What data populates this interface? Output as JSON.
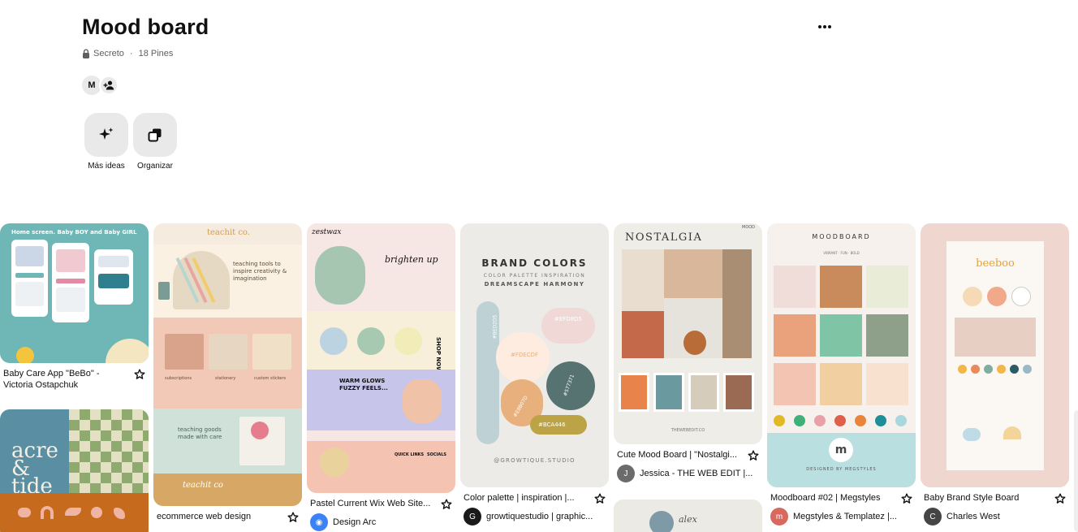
{
  "board": {
    "title": "Mood board",
    "privacy": "Secreto",
    "separator": "·",
    "pin_count": "18 Pines",
    "collaborator_initial": "M",
    "more_options_icon": "ellipsis-icon"
  },
  "actions": [
    {
      "label": "Más ideas",
      "icon": "sparkle-icon"
    },
    {
      "label": "Organizar",
      "icon": "organize-icon"
    }
  ],
  "pins": [
    {
      "title": "Baby Care App \"BeBo\" - Victoria Ostapchuk",
      "art": {
        "heading": "Home screen. Baby BOY and Baby GIRL"
      }
    },
    {
      "title": "ecommerce web design",
      "art": {
        "brand": "teachit co.",
        "line1": "teaching tools to inspire creativity & imagination",
        "line2": "subscriptions",
        "line3": "stationery",
        "line4": "custom stickers",
        "line5": "teaching goods made with care",
        "logo": "teachit co"
      }
    },
    {
      "title": "Pastel Current Wix Web Site...",
      "author": "Design Arc",
      "art": {
        "brand": "zestwax",
        "headline": "brighten up",
        "shop": "SHOP NOW",
        "warm": "WARM GLOWS FUZZY FEELS...",
        "quick": "QUICK LINKS",
        "socials": "SOCIALS"
      }
    },
    {
      "title": "Color palette | inspiration |...",
      "author": "growtiquestudio | graphic...",
      "art": {
        "heading": "BRAND COLORS",
        "sub": "COLOR PALETTE INSPIRATION",
        "name": "DREAMSCAPE HARMONY",
        "hex1": "#EFD8D5",
        "hex2": "#FDECDF",
        "hex3": "#577371",
        "hex4": "#BED2D5",
        "hex5": "#E8B07D",
        "hex6": "#BCA446",
        "footer": "@GROWTIQUE.STUDIO"
      }
    },
    {
      "title": "Cute Mood Board | \"Nostalgi...",
      "author": "Jessica - THE WEB EDIT |...",
      "art": {
        "heading": "NOSTALGIA",
        "corner": "MOOD",
        "footer": "THEWEBEDIT.CO"
      }
    },
    {
      "title": "Moodboard #02 | Megstyles",
      "author": "Megstyles & Templatez |...",
      "art": {
        "heading": "MOODBOARD",
        "tags": "VIBRANT · FUN · BOLD",
        "seal": "m",
        "footer": "DESIGNED BY MEGSTYLES"
      }
    },
    {
      "title": "Baby Brand Style Board",
      "author": "Charles West",
      "art": {
        "brand": "beeboo"
      }
    },
    {
      "title": "",
      "art": {
        "brand": "acre & tide"
      }
    },
    {
      "title": "",
      "art": {
        "brand": "alex"
      }
    }
  ],
  "colors": {
    "button_bg": "#e9e9e9",
    "text_primary": "#111111",
    "text_secondary": "#5f5f5f"
  }
}
